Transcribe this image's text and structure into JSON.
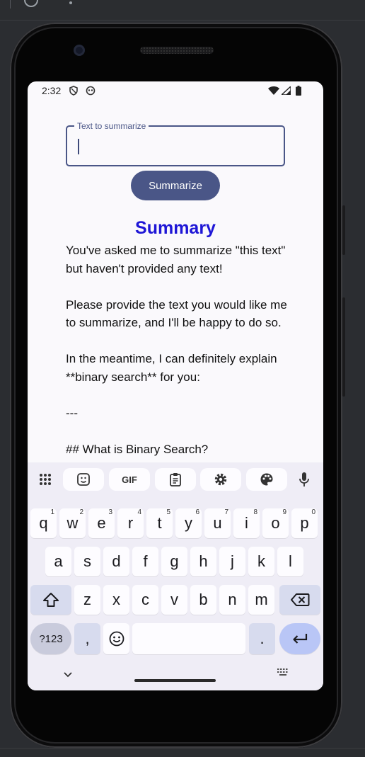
{
  "status_bar": {
    "time": "2:32",
    "icons": [
      "shield-icon",
      "assistant-icon",
      "wifi-icon",
      "signal-icon",
      "battery-icon"
    ]
  },
  "input": {
    "label": "Text to summarize",
    "value": ""
  },
  "summarize_button": {
    "label": "Summarize"
  },
  "summary": {
    "title": "Summary",
    "paragraphs": [
      "You've asked me to summarize \"this text\" but haven't provided any text!",
      "Please provide the text you would like me to summarize, and I'll be happy to do so.",
      "In the meantime, I can definitely explain **binary search** for you:",
      "---",
      "## What is Binary Search?"
    ]
  },
  "keyboard": {
    "toolbar": [
      "apps-grid-icon",
      "sticker-icon",
      "GIF",
      "clipboard-icon",
      "settings-icon",
      "palette-icon",
      "mic-icon"
    ],
    "row1": [
      {
        "label": "q",
        "hint": "1"
      },
      {
        "label": "w",
        "hint": "2"
      },
      {
        "label": "e",
        "hint": "3"
      },
      {
        "label": "r",
        "hint": "4"
      },
      {
        "label": "t",
        "hint": "5"
      },
      {
        "label": "y",
        "hint": "6"
      },
      {
        "label": "u",
        "hint": "7"
      },
      {
        "label": "i",
        "hint": "8"
      },
      {
        "label": "o",
        "hint": "9"
      },
      {
        "label": "p",
        "hint": "0"
      }
    ],
    "row2": [
      "a",
      "s",
      "d",
      "f",
      "g",
      "h",
      "j",
      "k",
      "l"
    ],
    "row3": [
      "z",
      "x",
      "c",
      "v",
      "b",
      "n",
      "m"
    ],
    "symbols_label": "?123",
    "comma": ",",
    "period": "."
  },
  "colors": {
    "accent": "#4a5687",
    "title": "#1e16d6",
    "screen_bg": "#faf9fc",
    "keyboard_bg": "#efedf6"
  }
}
